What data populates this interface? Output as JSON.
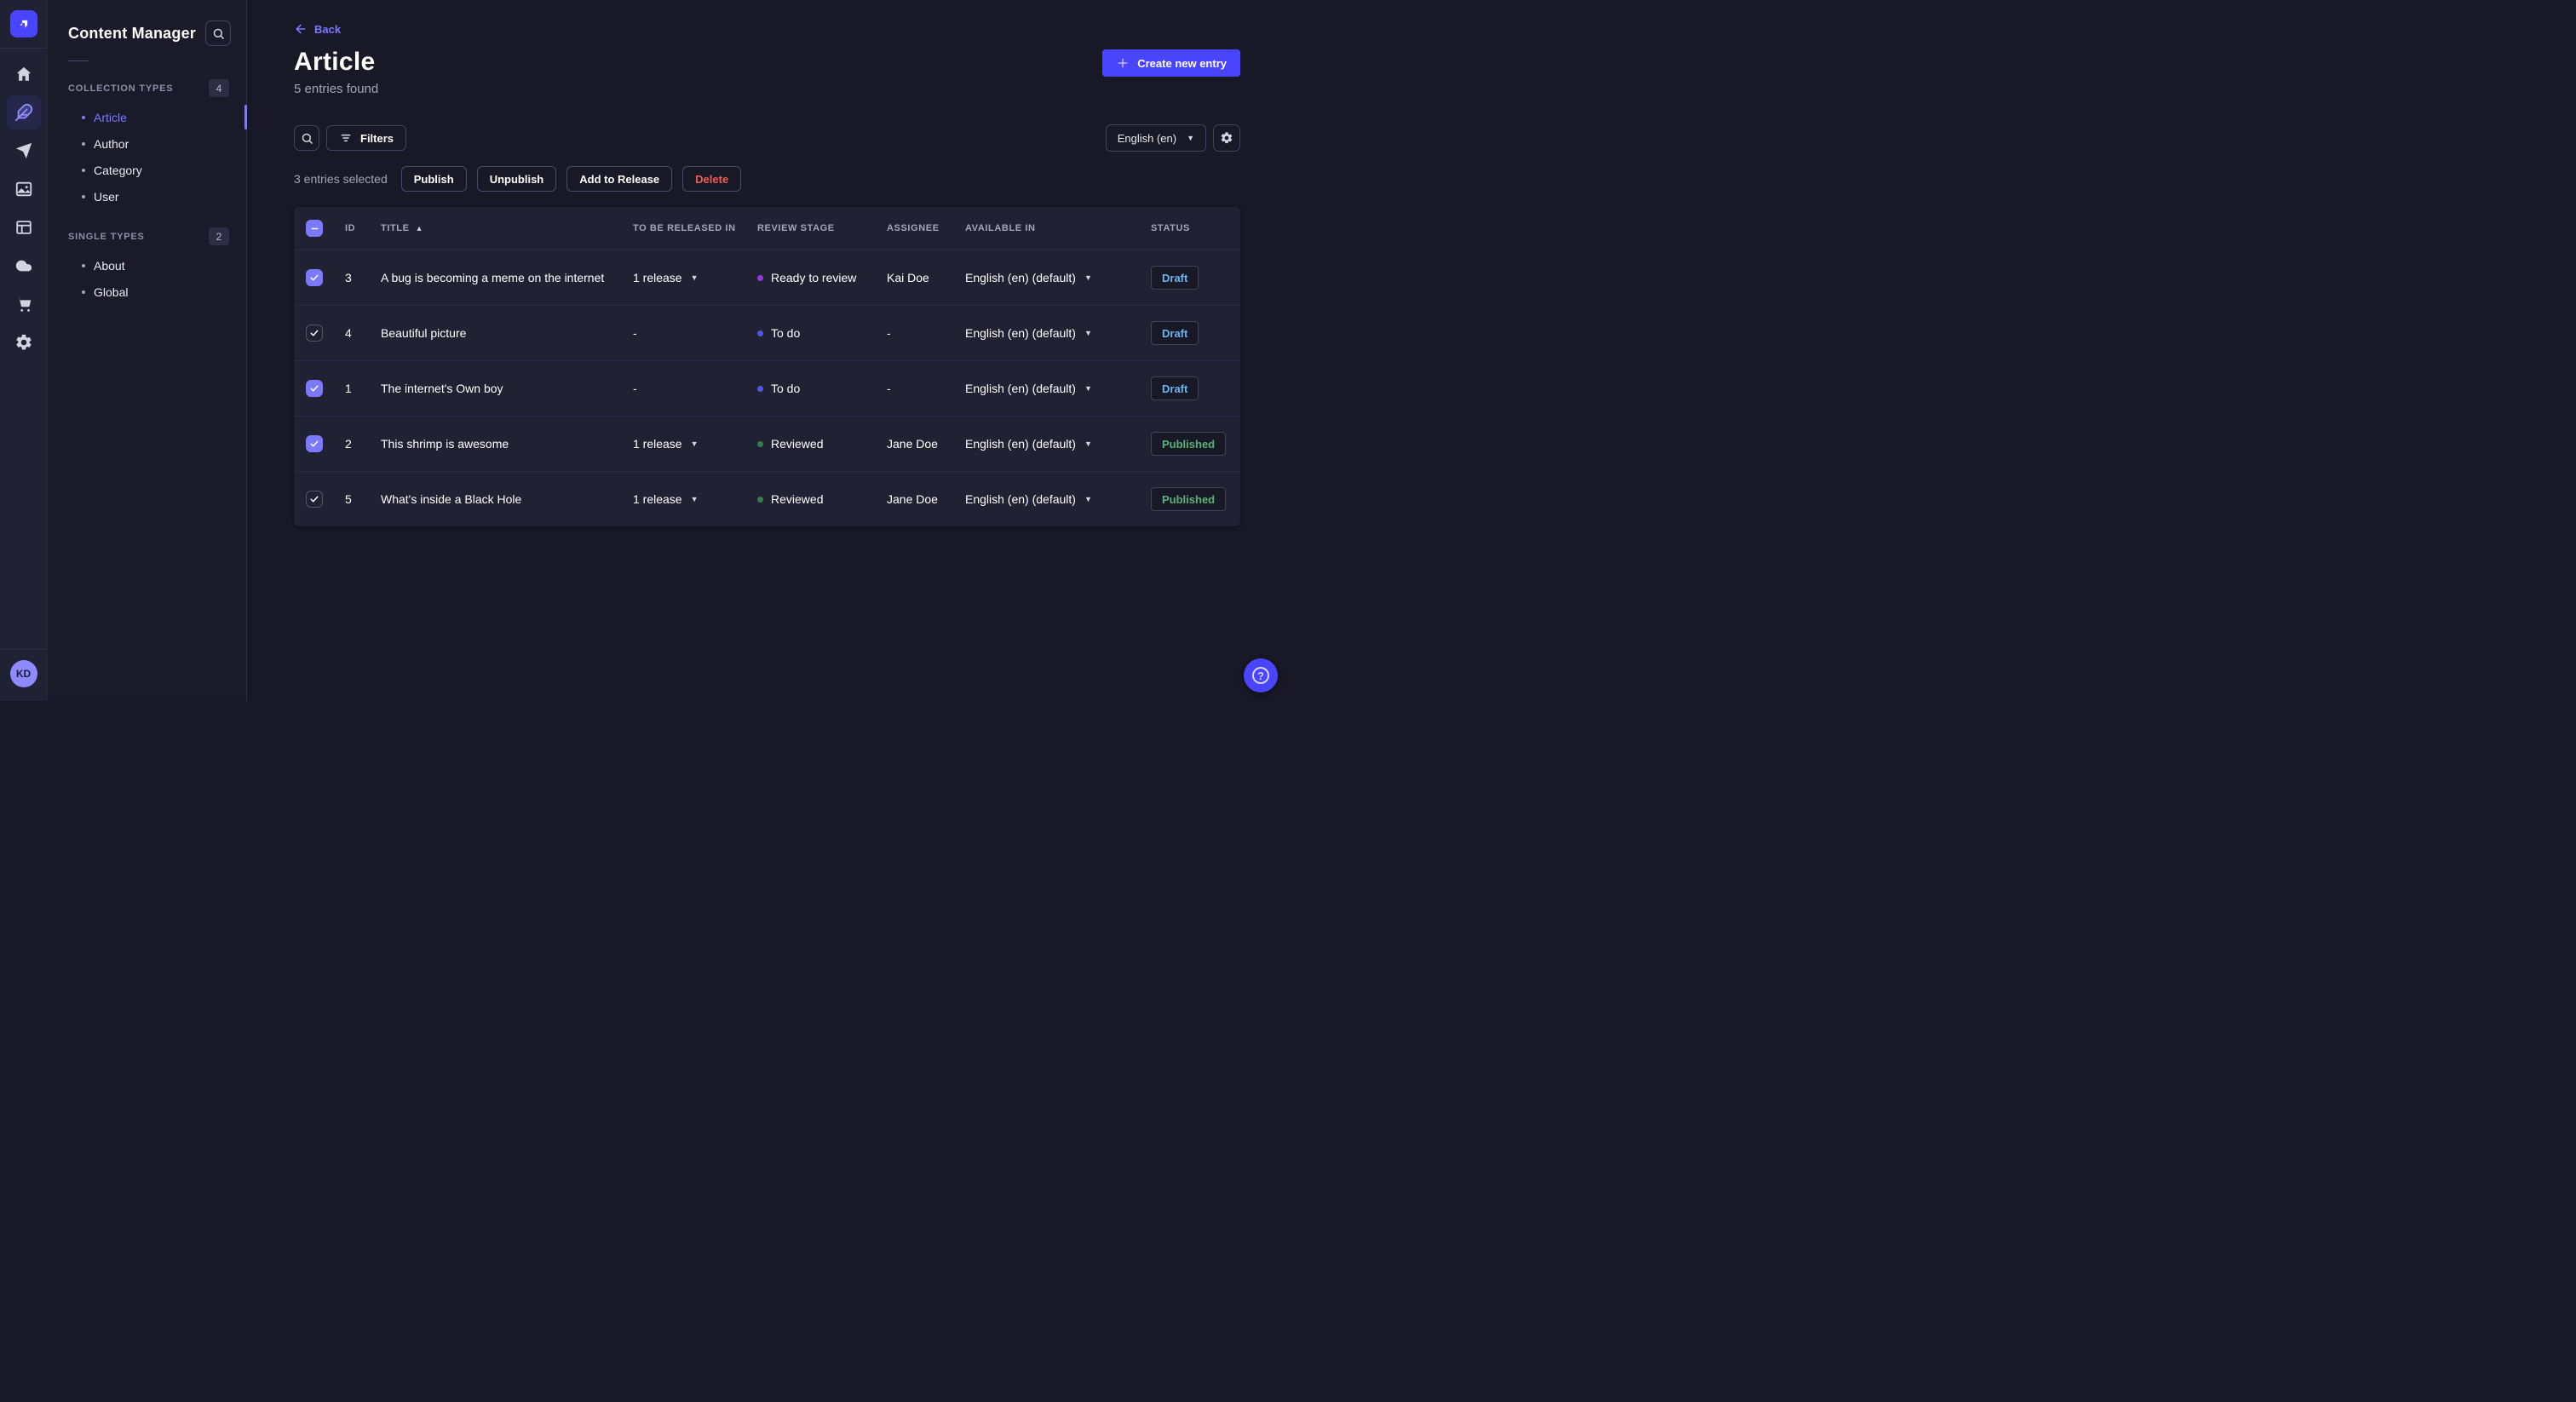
{
  "sidebar": {
    "logo_name": "strapi-logo",
    "nav_icons": [
      "home",
      "content-manager-feather",
      "releases-paper-plane",
      "media-library-images",
      "content-type-builder-layout",
      "deploy-cloud",
      "marketplace-cart",
      "settings-gear"
    ],
    "avatar_initials": "KD"
  },
  "subnav": {
    "title": "Content Manager",
    "sections": [
      {
        "label": "COLLECTION TYPES",
        "count": "4",
        "items": [
          {
            "label": "Article"
          },
          {
            "label": "Author"
          },
          {
            "label": "Category"
          },
          {
            "label": "User"
          }
        ]
      },
      {
        "label": "SINGLE TYPES",
        "count": "2",
        "items": [
          {
            "label": "About"
          },
          {
            "label": "Global"
          }
        ]
      }
    ]
  },
  "header": {
    "back_label": "Back",
    "title": "Article",
    "subtitle": "5 entries found",
    "create_button_label": "Create new entry"
  },
  "toolbar": {
    "filters_label": "Filters",
    "locale_value": "English (en)"
  },
  "selection": {
    "text": "3 entries selected",
    "actions": [
      "Publish",
      "Unpublish",
      "Add to Release",
      "Delete"
    ]
  },
  "table": {
    "columns": [
      "ID",
      "TITLE",
      "TO BE RELEASED IN",
      "REVIEW STAGE",
      "ASSIGNEE",
      "AVAILABLE IN",
      "STATUS"
    ],
    "sorted_column": "TITLE",
    "sort_direction": "ascending",
    "rows": [
      {
        "checked": true,
        "id": "3",
        "title": "A bug is becoming a meme on the internet",
        "release": "1 release",
        "stage": "Ready to review",
        "stage_color": "#9736e8",
        "assignee": "Kai Doe",
        "locale": "English (en) (default)",
        "status": "Draft"
      },
      {
        "checked": false,
        "id": "4",
        "title": "Beautiful picture",
        "release": "-",
        "stage": "To do",
        "stage_color": "#5056e8",
        "assignee": "-",
        "locale": "English (en) (default)",
        "status": "Draft"
      },
      {
        "checked": true,
        "id": "1",
        "title": "The internet's Own boy",
        "release": "-",
        "stage": "To do",
        "stage_color": "#5056e8",
        "assignee": "-",
        "locale": "English (en) (default)",
        "status": "Draft"
      },
      {
        "checked": true,
        "id": "2",
        "title": "This shrimp is awesome",
        "release": "1 release",
        "stage": "Reviewed",
        "stage_color": "#328048",
        "assignee": "Jane Doe",
        "locale": "English (en) (default)",
        "status": "Published"
      },
      {
        "checked": false,
        "id": "5",
        "title": "What's inside a Black Hole",
        "release": "1 release",
        "stage": "Reviewed",
        "stage_color": "#328048",
        "assignee": "Jane Doe",
        "locale": "English (en) (default)",
        "status": "Published"
      }
    ]
  },
  "colors": {
    "accent": "#4945ff",
    "link": "#7b79ff",
    "danger": "#ee5e52",
    "status_draft": "#66b7f1",
    "status_published": "#5cb176",
    "page_bg": "#181826",
    "surface_bg": "#212134"
  }
}
